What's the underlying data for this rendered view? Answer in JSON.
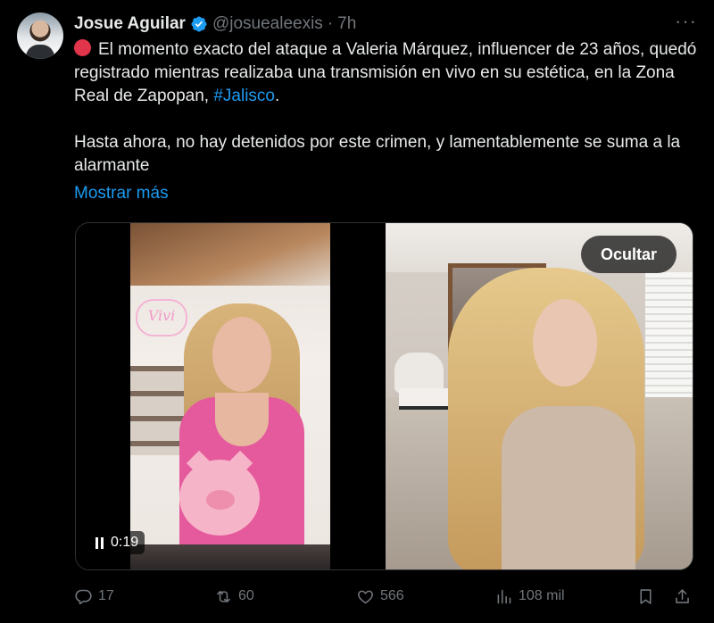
{
  "author": {
    "display_name": "Josue Aguilar",
    "handle": "@josuealeexis",
    "separator": "·",
    "time": "7h",
    "verified": true
  },
  "tweet": {
    "paragraph1_main": "El momento exacto del ataque a Valeria Márquez, influencer de 23 años, quedó registrado mientras realizaba una transmisión en vivo en su estética, en la Zona Real de Zapopan, ",
    "hashtag": "#Jalisco",
    "paragraph1_end": ".",
    "paragraph2": "Hasta ahora, no hay detenidos por este crimen, y lamentablemente se suma a la alarmante",
    "show_more": "Mostrar más",
    "emoji": "red-circle-emoji"
  },
  "media": {
    "video_time": "0:19",
    "hide_label": "Ocultar",
    "neon_sign": "Vivi"
  },
  "actions": {
    "replies": "17",
    "retweets": "60",
    "likes": "566",
    "views": "108 mil"
  },
  "colors": {
    "background": "#000000",
    "text": "#e7e9ea",
    "secondary": "#71767b",
    "link": "#1d9bf0",
    "verified": "#1d9bf0",
    "red_circle": "#e0354a"
  },
  "icons": {
    "more": "more-horizontal-icon",
    "reply": "reply-icon",
    "retweet": "retweet-icon",
    "like": "heart-icon",
    "views": "views-icon",
    "bookmark": "bookmark-icon",
    "share": "share-icon"
  }
}
